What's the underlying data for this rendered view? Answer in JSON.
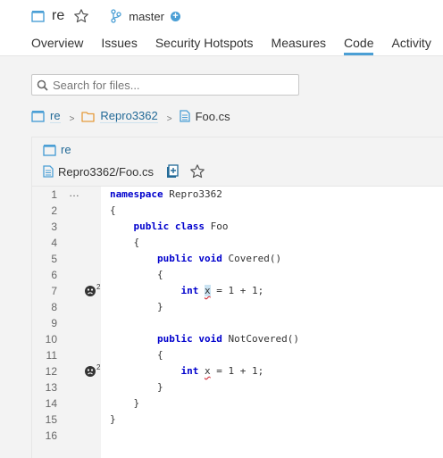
{
  "project": {
    "name": "re",
    "branch": "master"
  },
  "nav": [
    "Overview",
    "Issues",
    "Security Hotspots",
    "Measures",
    "Code",
    "Activity"
  ],
  "nav_active": "Code",
  "search": {
    "placeholder": "Search for files..."
  },
  "breadcrumb": {
    "project": "re",
    "folder": "Repro3362",
    "file": "Foo.cs"
  },
  "viewer": {
    "project": "re",
    "file_path": "Repro3362/Foo.cs"
  },
  "code": {
    "lines": [
      {
        "n": "1",
        "dots": "…"
      },
      {
        "n": "2"
      },
      {
        "n": "3"
      },
      {
        "n": "4"
      },
      {
        "n": "5"
      },
      {
        "n": "6"
      },
      {
        "n": "7",
        "issues": "2"
      },
      {
        "n": "8"
      },
      {
        "n": "9"
      },
      {
        "n": "10"
      },
      {
        "n": "11"
      },
      {
        "n": "12",
        "issues": "2"
      },
      {
        "n": "13"
      },
      {
        "n": "14"
      },
      {
        "n": "15"
      },
      {
        "n": "16"
      }
    ],
    "tokens": {
      "namespace": "namespace",
      "ns_name": "Repro3362",
      "public": "public",
      "class": "class",
      "class_name": "Foo",
      "void": "void",
      "m1": "Covered()",
      "m2": "NotCovered()",
      "int": "int",
      "var": "x",
      "expr": "= 1 + 1;",
      "open": "{",
      "close": "}"
    }
  },
  "colors": {
    "accent": "#4b9fd5",
    "link": "#236a97",
    "keyword": "#0000cd",
    "squiggle": "#d02f3a"
  }
}
